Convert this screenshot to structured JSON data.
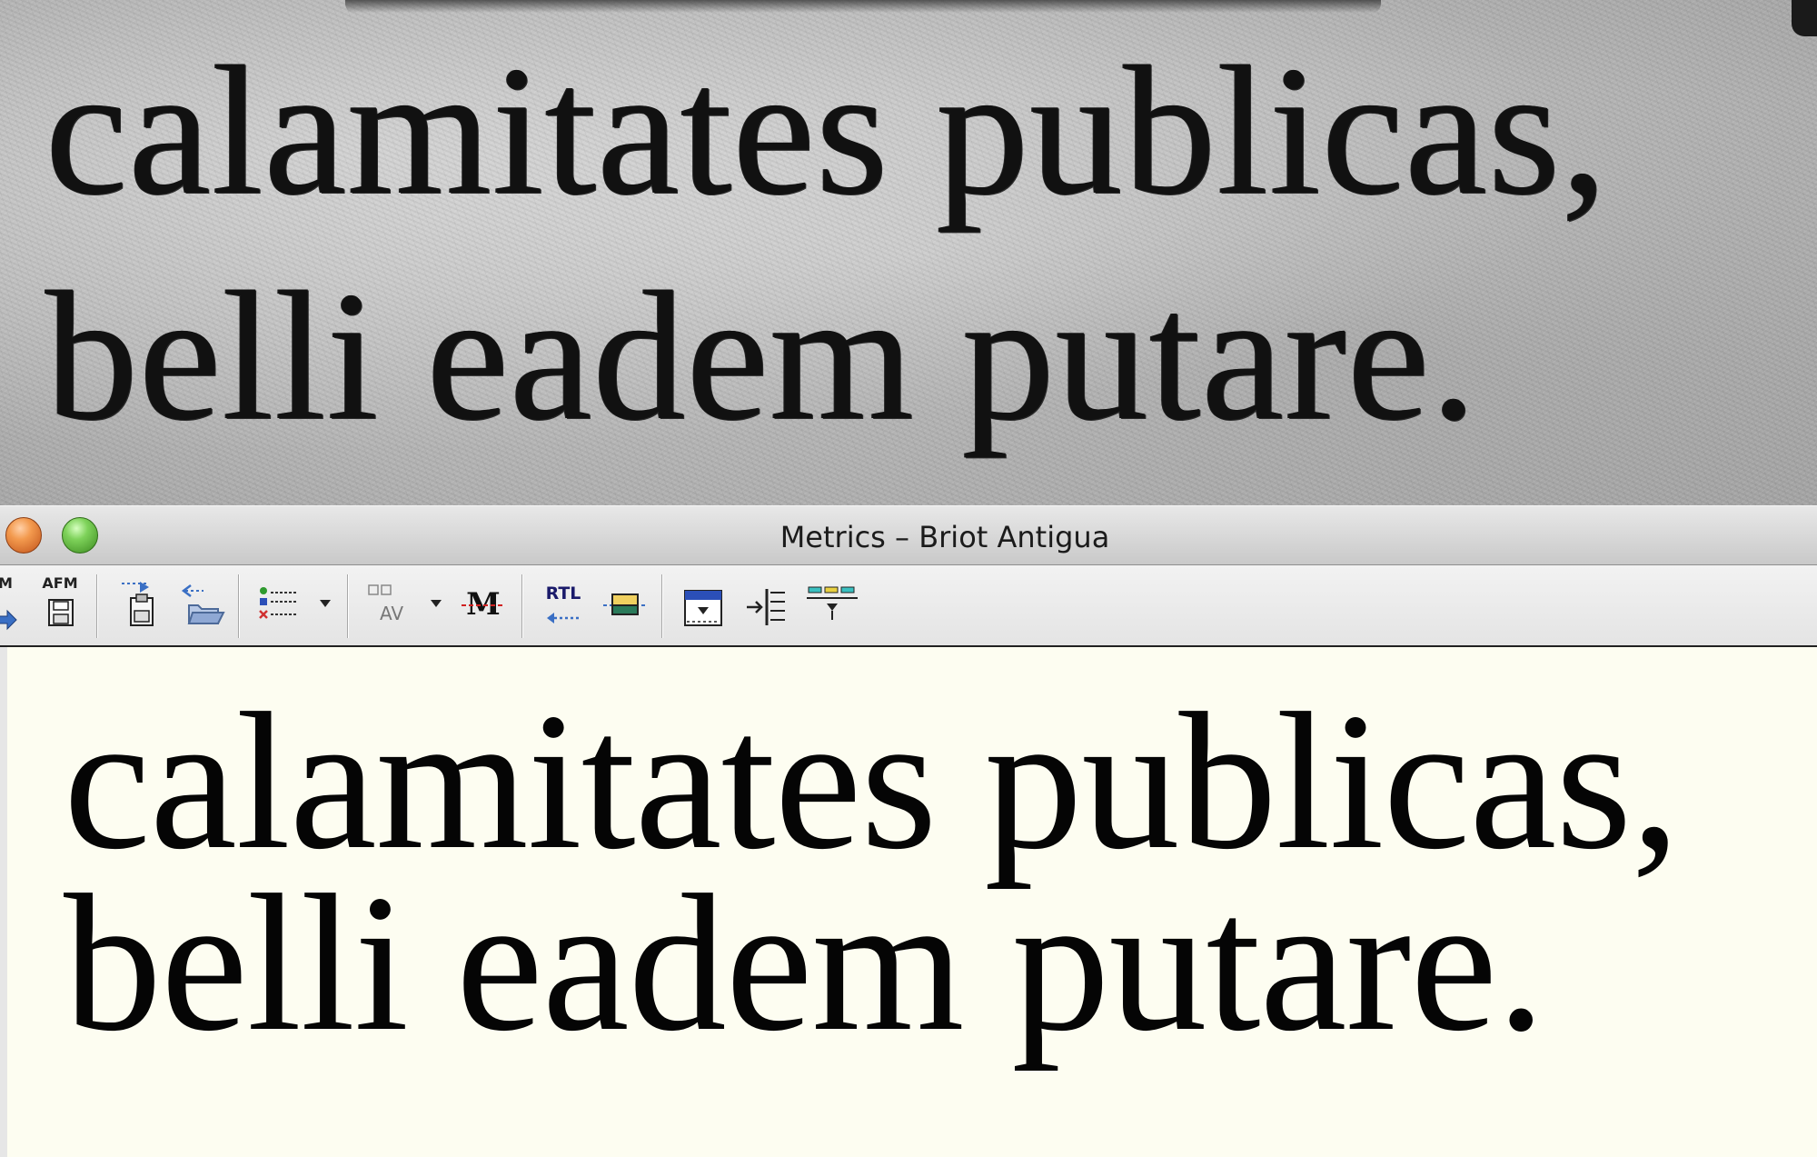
{
  "scan": {
    "line1": "calamitates publicas,",
    "line2": "belli  eadem putare."
  },
  "window": {
    "title": "Metrics – Briot Antigua"
  },
  "toolbar": {
    "buttons": [
      {
        "name": "import-metrics",
        "label": "M",
        "icon": "import-arrow-icon"
      },
      {
        "name": "export-afm",
        "label": "AFM",
        "icon": "save-disk-icon"
      },
      {
        "name": "insert-glyph",
        "label": "",
        "icon": "insert-clipboard-icon"
      },
      {
        "name": "open-file",
        "label": "",
        "icon": "open-folder-icon"
      },
      {
        "name": "glyph-list",
        "label": "",
        "icon": "list-icon"
      },
      {
        "name": "kerning-pair",
        "label": "AV",
        "icon": "kerning-icon"
      },
      {
        "name": "strike-metric",
        "label": "M",
        "icon": "strike-m-icon"
      },
      {
        "name": "right-to-left",
        "label": "RTL",
        "icon": "rtl-arrow-icon"
      },
      {
        "name": "baseline-box",
        "label": "",
        "icon": "baseline-box-icon"
      },
      {
        "name": "align-top",
        "label": "",
        "icon": "align-top-icon"
      },
      {
        "name": "insert-width",
        "label": "",
        "icon": "insert-width-icon"
      },
      {
        "name": "split-lines",
        "label": "",
        "icon": "split-lines-icon"
      }
    ]
  },
  "metrics_text": {
    "line1": "calamitates publicas,",
    "line2": "belli eadem putare."
  },
  "colors": {
    "content_bg": "#fdfdf1",
    "close_button": "#e8762e",
    "zoom_button": "#5fb83c"
  }
}
